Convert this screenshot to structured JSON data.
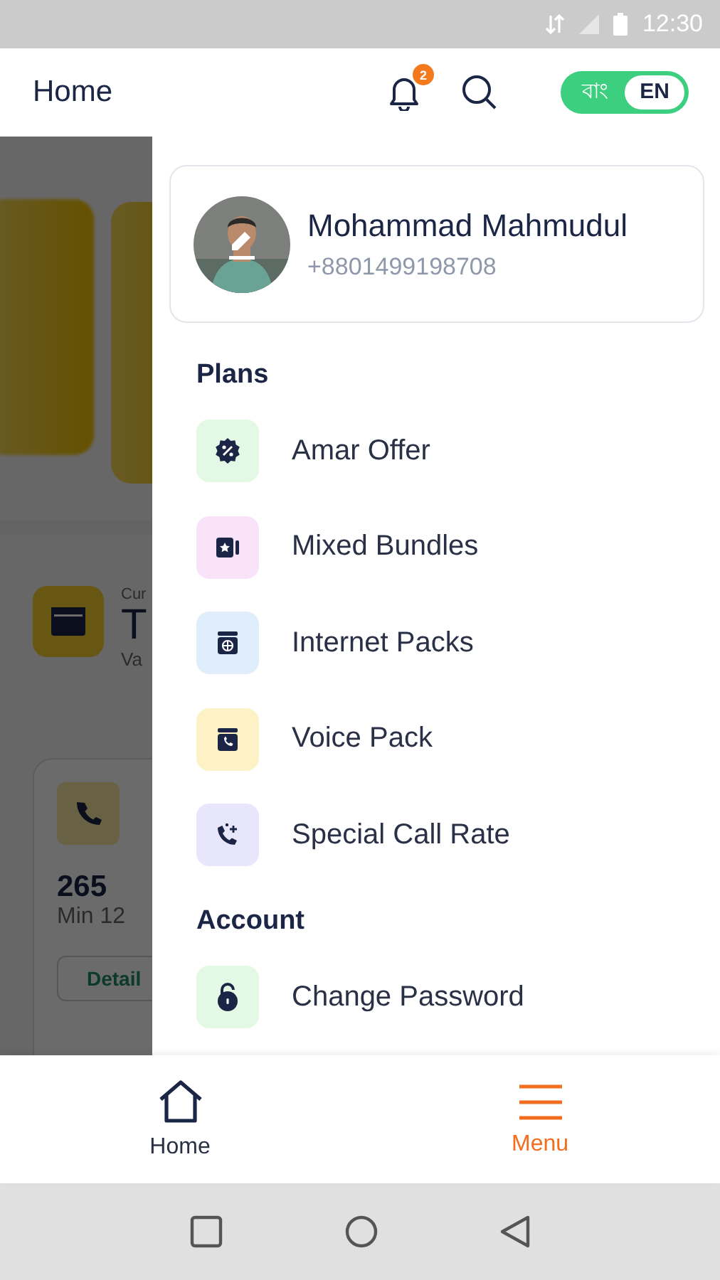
{
  "status_bar": {
    "time": "12:30"
  },
  "app_bar": {
    "title": "Home",
    "notification_count": "2",
    "languages": [
      {
        "label": "বাং",
        "selected": false
      },
      {
        "label": "EN",
        "selected": true
      }
    ]
  },
  "background": {
    "balance_label": "Cur",
    "balance_value": "T",
    "validity": "Va",
    "minutes_value": "265",
    "minutes_note": "Min 12",
    "details_button": "Detail"
  },
  "drawer": {
    "profile": {
      "name": "Mohammad Mahmudul",
      "phone": "+8801499198708"
    },
    "sections": [
      {
        "title": "Plans",
        "items": [
          {
            "label": "Amar Offer",
            "kind": "offer",
            "color": "#e3f9e5"
          },
          {
            "label": "Mixed Bundles",
            "kind": "bundle",
            "color": "#f9e3f9"
          },
          {
            "label": "Internet Packs",
            "kind": "internet",
            "color": "#e0eefc"
          },
          {
            "label": "Voice Pack",
            "kind": "voice",
            "color": "#fdf2c6"
          },
          {
            "label": "Special Call Rate",
            "kind": "callrate",
            "color": "#e7e6fb"
          }
        ]
      },
      {
        "title": "Account",
        "items": [
          {
            "label": "Change Password",
            "kind": "lock",
            "color": "#e3f9e5"
          }
        ]
      }
    ]
  },
  "bottom_nav": [
    {
      "label": "Home",
      "kind": "home",
      "selected": false
    },
    {
      "label": "Menu",
      "kind": "menu",
      "selected": true
    }
  ]
}
